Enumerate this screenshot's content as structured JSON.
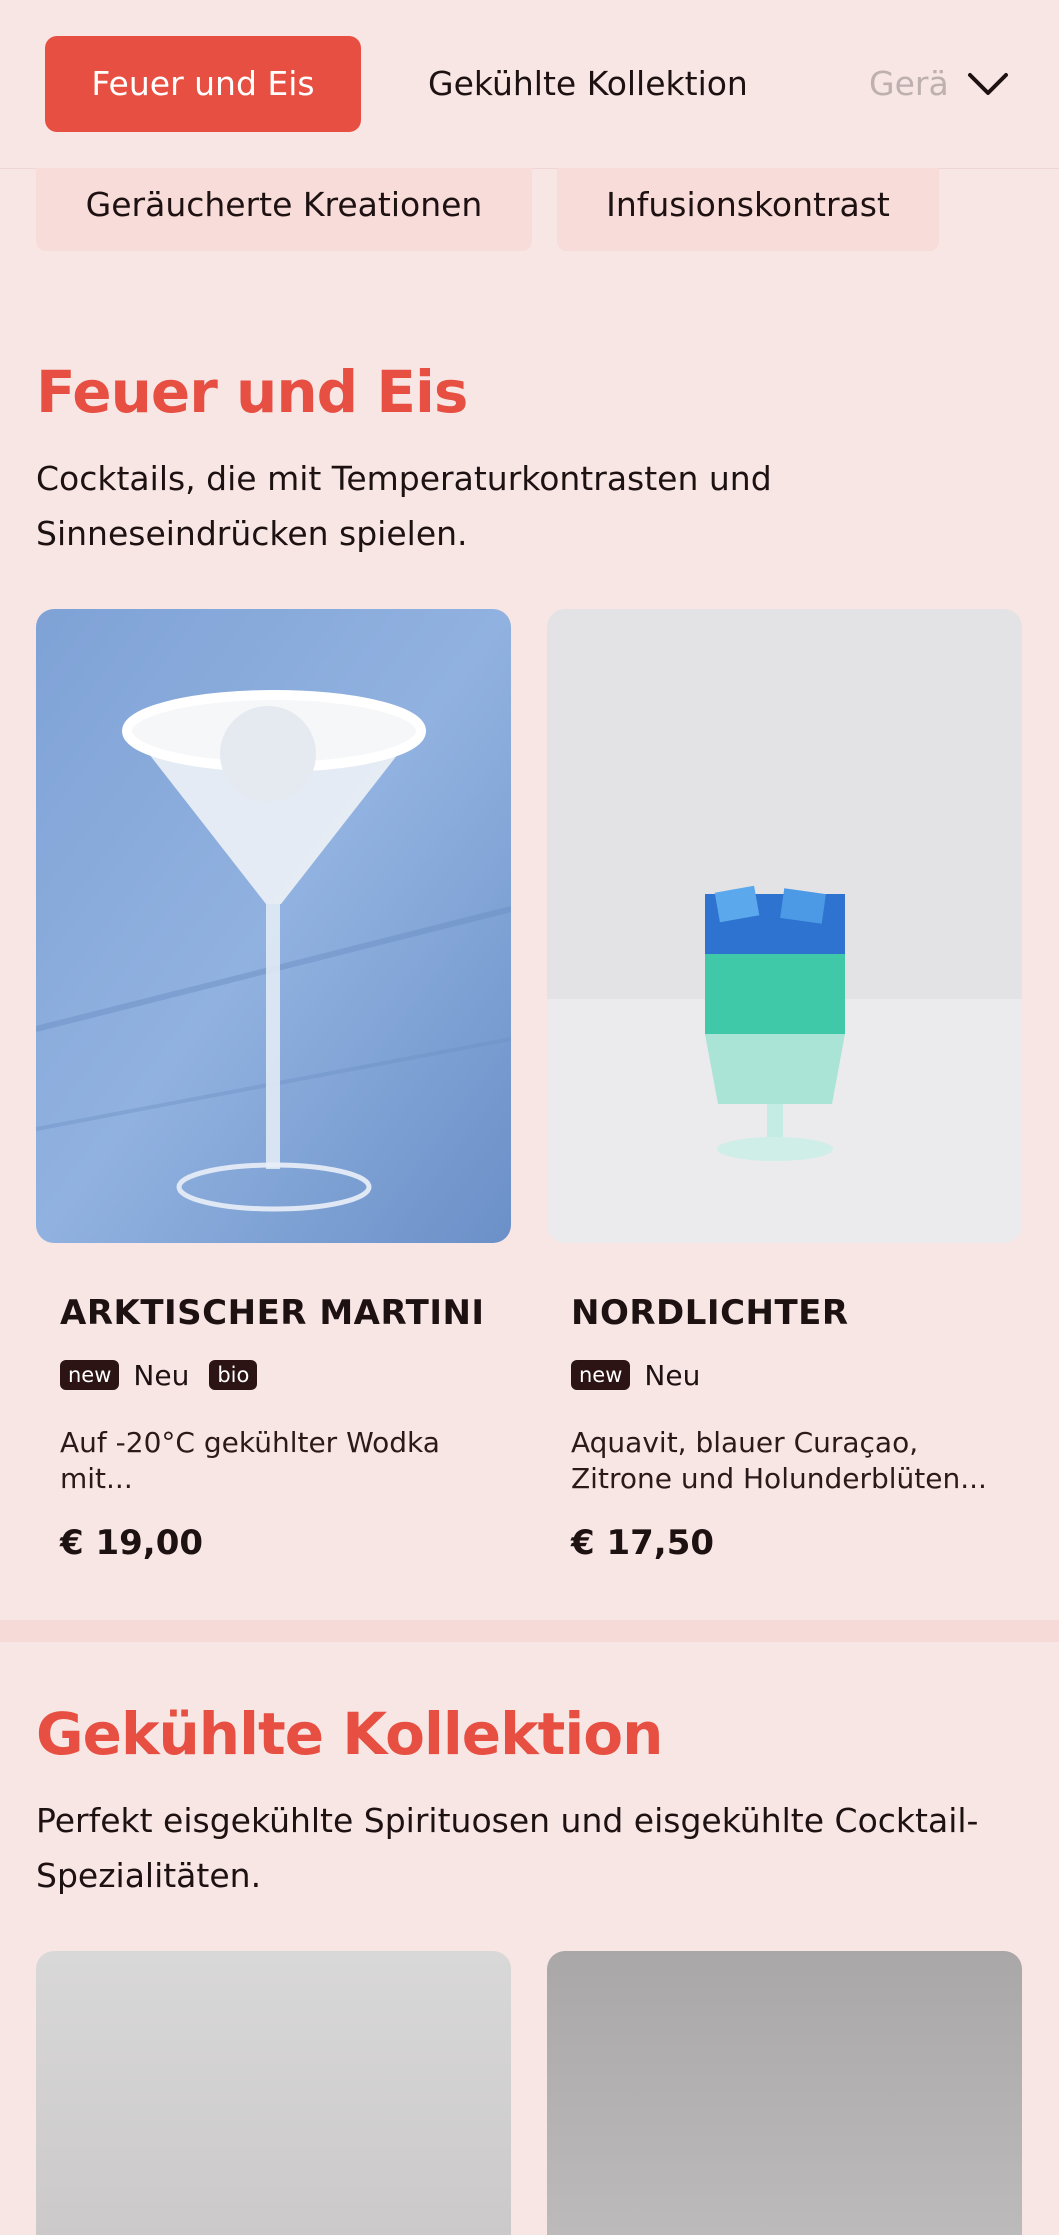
{
  "nav": {
    "tabs": [
      "Feuer und Eis",
      "Gekühlte Kollektion",
      "Geräucherte Kreationen"
    ],
    "active_index": 0,
    "more_icon": "chevron-down-icon",
    "sub_tabs": [
      "Geräucherte Kreationen",
      "Infusionskontrast"
    ]
  },
  "sections": [
    {
      "title": "Feuer und Eis",
      "description": "Cocktails, die mit Temperaturkontrasten und Sinneseindrücken spielen.",
      "items": [
        {
          "name": "ARKTISCHER MARTINI",
          "badges": [
            {
              "tag": "new",
              "label": "Neu"
            },
            {
              "tag": "bio",
              "label": ""
            }
          ],
          "description": "Auf -20°C gekühlter Wodka mit...",
          "price": "€ 19,00"
        },
        {
          "name": "NORDLICHTER",
          "badges": [
            {
              "tag": "new",
              "label": "Neu"
            }
          ],
          "description": "Aquavit, blauer Curaçao, Zitrone und Holunderblüten...",
          "price": "€ 17,50"
        }
      ]
    },
    {
      "title": "Gekühlte Kollektion",
      "description": "Perfekt eisgekühlte Spirituosen und eisgekühlte Cocktail-Spezialitäten."
    }
  ],
  "colors": {
    "accent": "#e64f41",
    "background": "#f8e6e5",
    "badge": "#2b1413"
  }
}
